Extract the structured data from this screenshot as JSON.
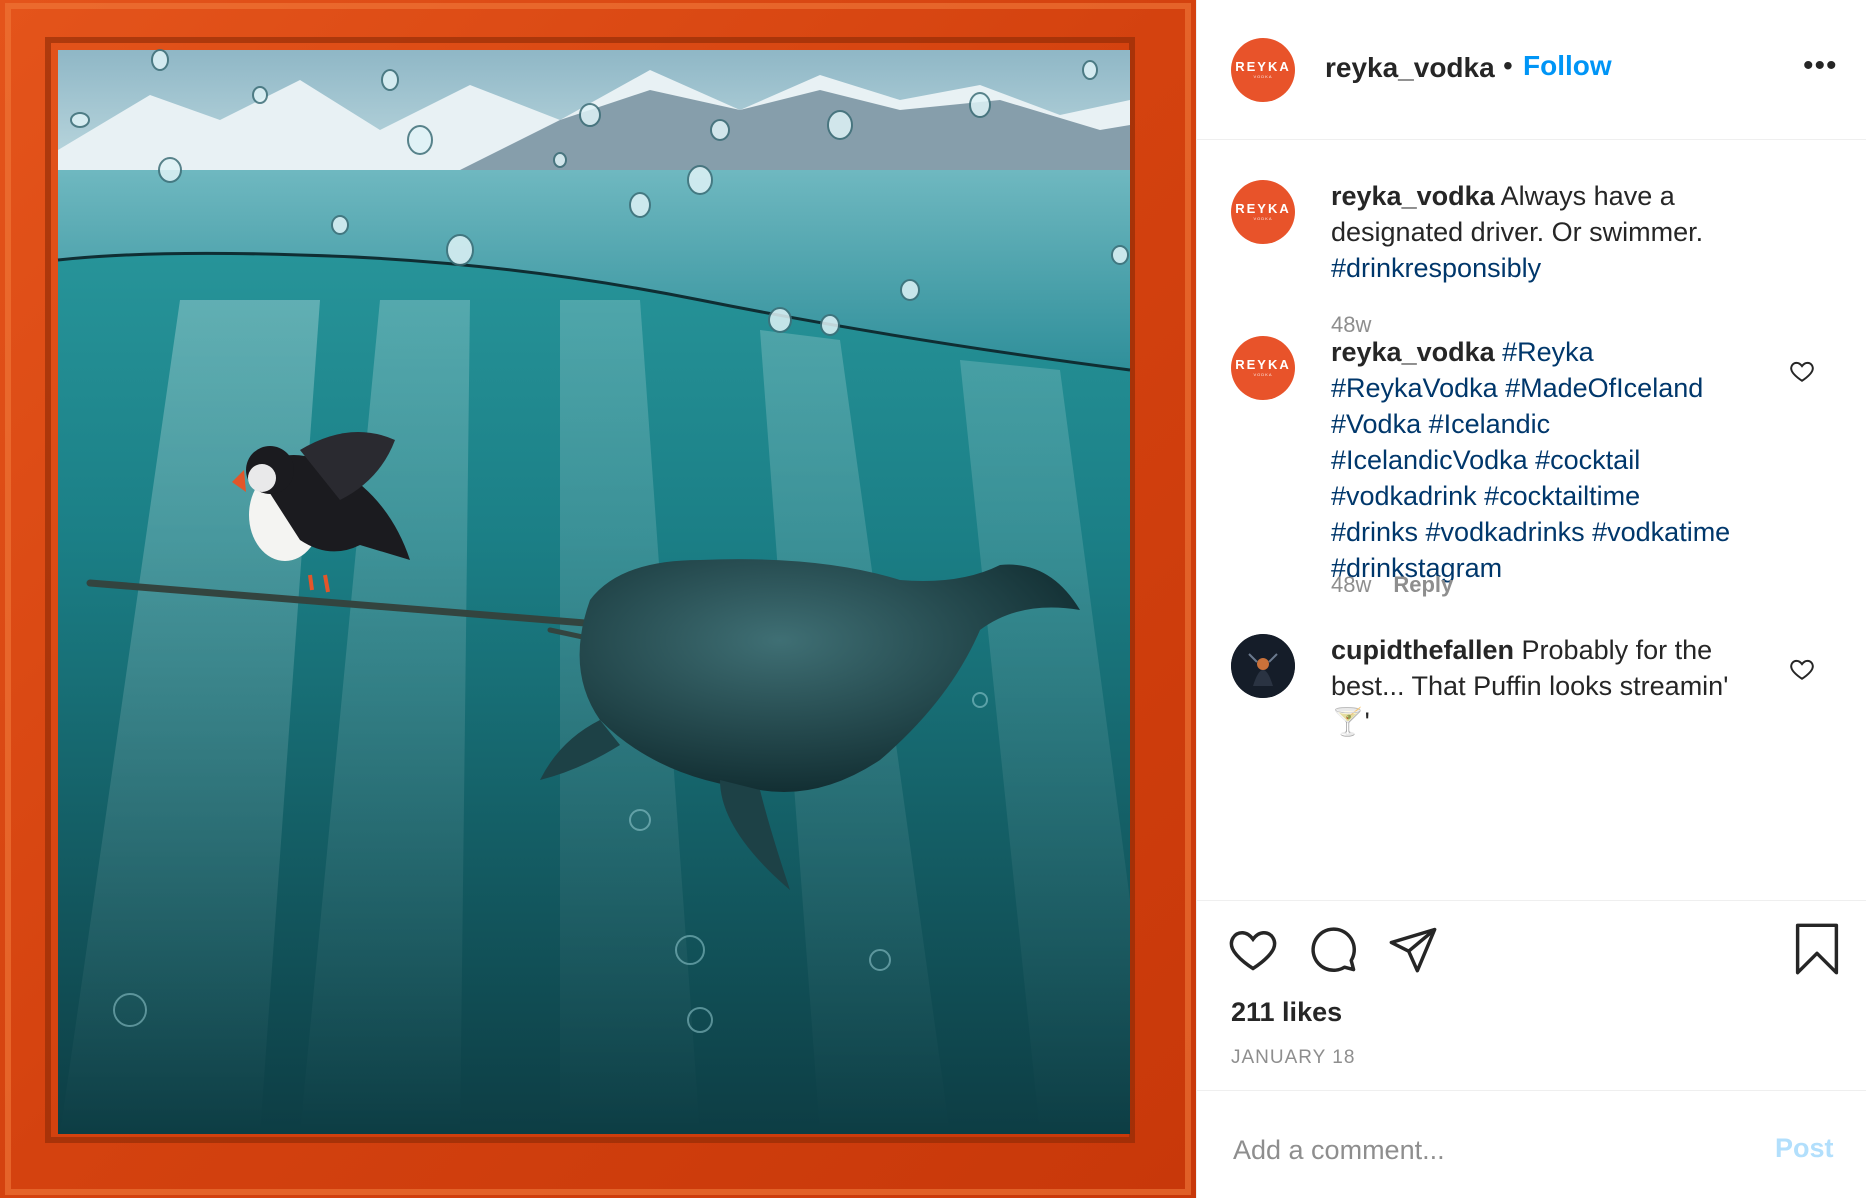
{
  "post_media": {
    "alt": "Underwater scene of a puffin riding a narwhal's tusk in an orange wooden frame"
  },
  "header": {
    "username": "reyka_vodka",
    "separator": "•",
    "follow_label": "Follow",
    "more_icon": "more-dots-icon",
    "avatar_brand": "REYKA",
    "avatar_sub": "VODKA"
  },
  "comments": [
    {
      "username": "reyka_vodka",
      "text": "Always have a designated driver. Or swimmer.",
      "hashtags": "#drinkresponsibly",
      "time": "48w"
    },
    {
      "username": "reyka_vodka",
      "hashtags": "#Reyka #ReykaVodka #MadeOfIceland #Vodka #Icelandic #IcelandicVodka #cocktail #vodkadrink #cocktailtime #drinks #vodkadrinks #vodkatime #drinkstagram",
      "time": "48w",
      "reply_label": "Reply"
    },
    {
      "username": "cupidthefallen",
      "text": "Probably for the best... That Puffin looks streamin' 🍸'"
    }
  ],
  "actions": {
    "like_icon": "heart-icon",
    "comment_icon": "comment-bubble-icon",
    "share_icon": "paper-plane-icon",
    "save_icon": "bookmark-icon",
    "likes_text": "211 likes",
    "date_text": "JANUARY 18"
  },
  "add_comment": {
    "placeholder": "Add a comment...",
    "post_label": "Post"
  },
  "colors": {
    "brand_orange": "#e8532a",
    "link_blue": "#0095f6",
    "hashtag_blue": "#00376b",
    "muted_gray": "#8e8e8e",
    "post_disabled": "#b2dffc"
  }
}
